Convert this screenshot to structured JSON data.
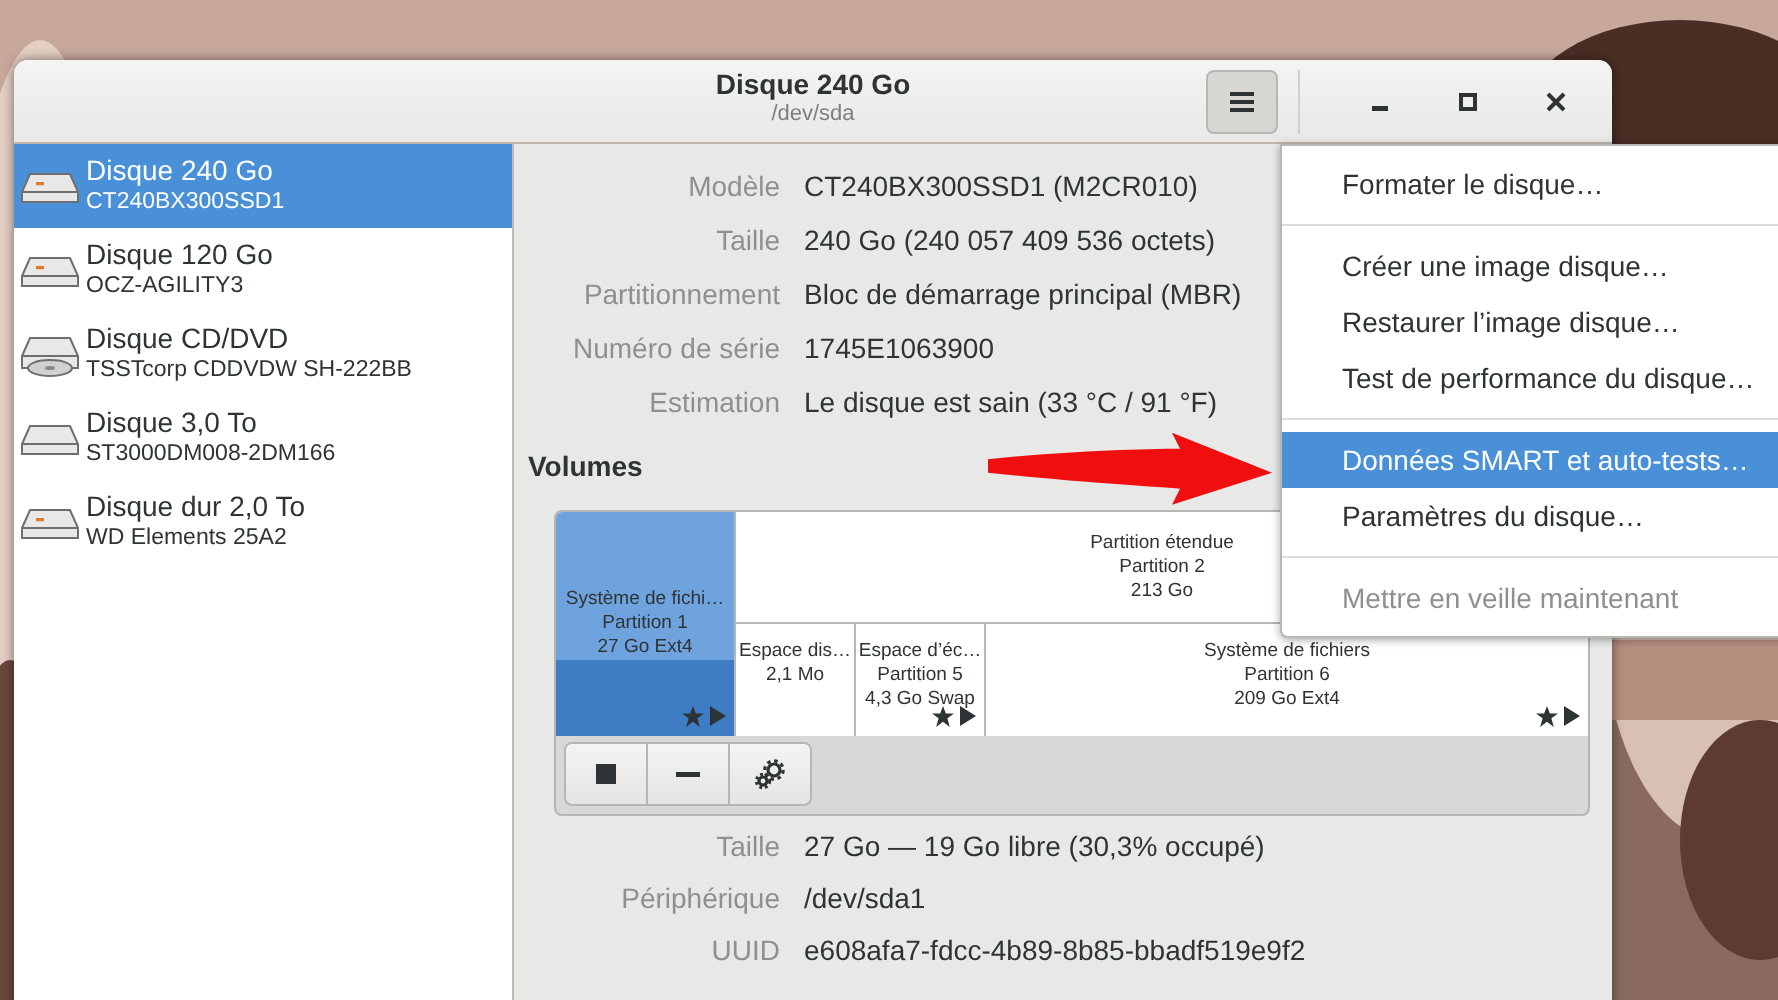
{
  "window": {
    "title": "Disque 240 Go",
    "subtitle": "/dev/sda",
    "menu_expanded": true
  },
  "sidebar": {
    "items": [
      {
        "kind": "ssd",
        "title": "Disque 240 Go",
        "subtitle": "CT240BX300SSD1",
        "selected": true
      },
      {
        "kind": "ssd",
        "title": "Disque 120 Go",
        "subtitle": "OCZ-AGILITY3",
        "selected": false
      },
      {
        "kind": "optical",
        "title": "Disque CD/DVD",
        "subtitle": "TSSTcorp CDDVDW SH-222BB",
        "selected": false
      },
      {
        "kind": "hdd",
        "title": "Disque 3,0 To",
        "subtitle": "ST3000DM008-2DM166",
        "selected": false
      },
      {
        "kind": "ssd",
        "title": "Disque dur 2,0 To",
        "subtitle": "WD Elements 25A2",
        "selected": false
      }
    ]
  },
  "disk_info": [
    {
      "label": "Modèle",
      "value": "CT240BX300SSD1 (M2CR010)"
    },
    {
      "label": "Taille",
      "value": "240 Go (240 057 409 536 octets)"
    },
    {
      "label": "Partitionnement",
      "value": "Bloc de démarrage principal (MBR)"
    },
    {
      "label": "Numéro de série",
      "value": "1745E1063900"
    },
    {
      "label": "Estimation",
      "value": "Le disque est sain (33 °C / 91 °F)"
    }
  ],
  "volumes": {
    "heading": "Volumes",
    "partitions": [
      {
        "lines": [
          "Système de fichi…",
          "Partition 1",
          "27 Go Ext4"
        ],
        "selected": true,
        "mounted": true
      },
      {
        "lines": [
          "Partition étendue",
          "Partition 2",
          "213 Go"
        ],
        "selected": false,
        "mounted": false,
        "children": [
          {
            "lines": [
              "Espace dis…",
              "2,1 Mo"
            ],
            "selected": false,
            "mounted": false
          },
          {
            "lines": [
              "Espace d’éc…",
              "Partition 5",
              "4,3 Go Swap"
            ],
            "selected": false,
            "mounted": true
          },
          {
            "lines": [
              "Système de fichiers",
              "Partition 6",
              "209 Go Ext4"
            ],
            "selected": false,
            "mounted": true
          }
        ]
      }
    ]
  },
  "partition_info": [
    {
      "label": "Taille",
      "value": "27 Go — 19 Go libre (30,3% occupé)"
    },
    {
      "label": "Périphérique",
      "value": "/dev/sda1"
    },
    {
      "label": "UUID",
      "value": "e608afa7-fdcc-4b89-8b85-bbadf519e9f2"
    }
  ],
  "menu": {
    "sections": [
      [
        {
          "label": "Formater le disque…",
          "selected": false,
          "disabled": false
        }
      ],
      [
        {
          "label": "Créer une image disque…",
          "selected": false,
          "disabled": false
        },
        {
          "label": "Restaurer l’image disque…",
          "selected": false,
          "disabled": false
        },
        {
          "label": "Test de performance du disque…",
          "selected": false,
          "disabled": false
        }
      ],
      [
        {
          "label": "Données SMART et auto-tests…",
          "selected": true,
          "disabled": false
        },
        {
          "label": "Paramètres du disque…",
          "selected": false,
          "disabled": false
        }
      ],
      [
        {
          "label": "Mettre en veille maintenant",
          "selected": false,
          "disabled": true
        }
      ]
    ]
  }
}
